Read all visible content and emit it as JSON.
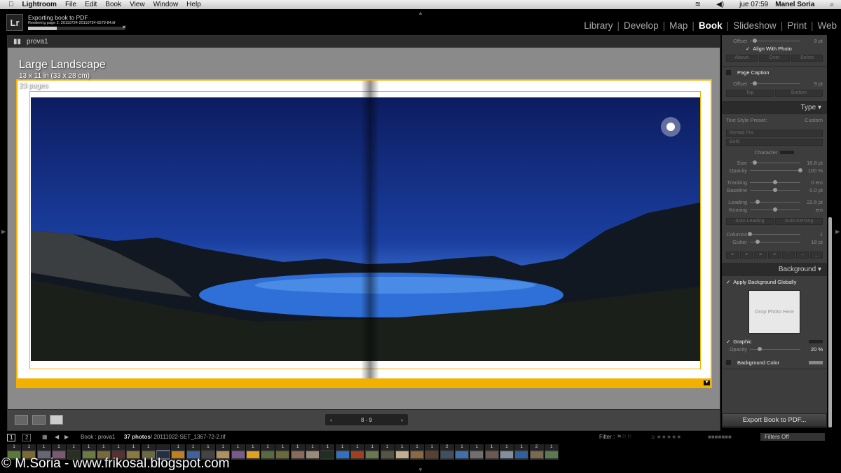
{
  "menubar": {
    "app": "Lightroom",
    "items": [
      "File",
      "Edit",
      "Book",
      "View",
      "Window",
      "Help"
    ],
    "clock": "jue 07:59",
    "user": "Manel Soria"
  },
  "export_progress": {
    "title": "Exporting book to PDF",
    "detail": "Rendering page 2: 20110724-20110724-6579-84.tif",
    "progress": 0.3,
    "logo": "Lr"
  },
  "modules": [
    "Library",
    "Develop",
    "Map",
    "Book",
    "Slideshow",
    "Print",
    "Web"
  ],
  "active_module": "Book",
  "collection": "prova1",
  "book": {
    "size_name": "Large Landscape",
    "dimensions": "13 x 11 in (33 x 28 cm)",
    "pages": "23 pages"
  },
  "pager": {
    "prev": "‹",
    "pages": "8 - 9",
    "next": "›"
  },
  "panel": {
    "caption_offset_label": "Offset",
    "caption_offset": "9 pt",
    "align_with_photo": "Align With Photo",
    "photo_caption_positions": [
      "Above",
      "Over",
      "Below"
    ],
    "page_caption": "Page Caption",
    "page_offset_label": "Offset",
    "page_offset": "9 pt",
    "page_caption_positions": [
      "Top",
      "Bottom"
    ],
    "type": {
      "header": "Type",
      "preset_label": "Text Style Preset:",
      "preset": "Custom",
      "font": "Myriad Pro",
      "style": "Bold",
      "character": "Character",
      "sliders": [
        {
          "label": "Size",
          "value": "18.8 pt",
          "pos": 0.1
        },
        {
          "label": "Opacity",
          "value": "100 %",
          "pos": 1
        },
        {
          "label": "Tracking",
          "value": "0 em",
          "pos": 0.5
        },
        {
          "label": "Baseline",
          "value": "0.0 pt",
          "pos": 0.5
        },
        {
          "label": "Leading",
          "value": "22.6 pt",
          "pos": 0.15
        },
        {
          "label": "Kerning",
          "value": "em",
          "pos": 0.5
        },
        {
          "label": "Columns",
          "value": "1",
          "pos": 0
        },
        {
          "label": "Gutter",
          "value": "18 pt",
          "pos": 0.15
        }
      ],
      "auto_leading": "Auto Leading",
      "auto_kerning": "Auto Kerning"
    },
    "background": {
      "header": "Background",
      "apply_globally": "Apply Background Globally",
      "drop_photo": "Drop Photo Here",
      "graphic": "Graphic",
      "opacity_label": "Opacity",
      "opacity": "20 %",
      "opacity_pos": 0.2,
      "background_color": "Background Color"
    },
    "export_button": "Export Book to PDF..."
  },
  "filmstrip": {
    "screens": [
      "1",
      "2"
    ],
    "source": "Book : prova1",
    "count": "37 photos",
    "filename": "/ 20111022-SET_1367-72-2.tif",
    "filter_label": "Filter :",
    "filter_value": "Filters Off",
    "badges": [
      "1",
      "1",
      "1",
      "1",
      "1",
      "1",
      "1",
      "1",
      "1",
      "1",
      "",
      "1",
      "1",
      "1",
      "1",
      "1",
      "1",
      "1",
      "1",
      "1",
      "1",
      "1",
      "1",
      "1",
      "1",
      "1",
      "1",
      "1",
      "1",
      "2",
      "1",
      "1",
      "1",
      "1",
      "1",
      "2",
      "1"
    ],
    "selected": 10
  },
  "watermark": "© M.Soria - www.frikosal.blogspot.com",
  "colors": {
    "accent": "#f2b000",
    "panel": "#3d3d3d"
  }
}
